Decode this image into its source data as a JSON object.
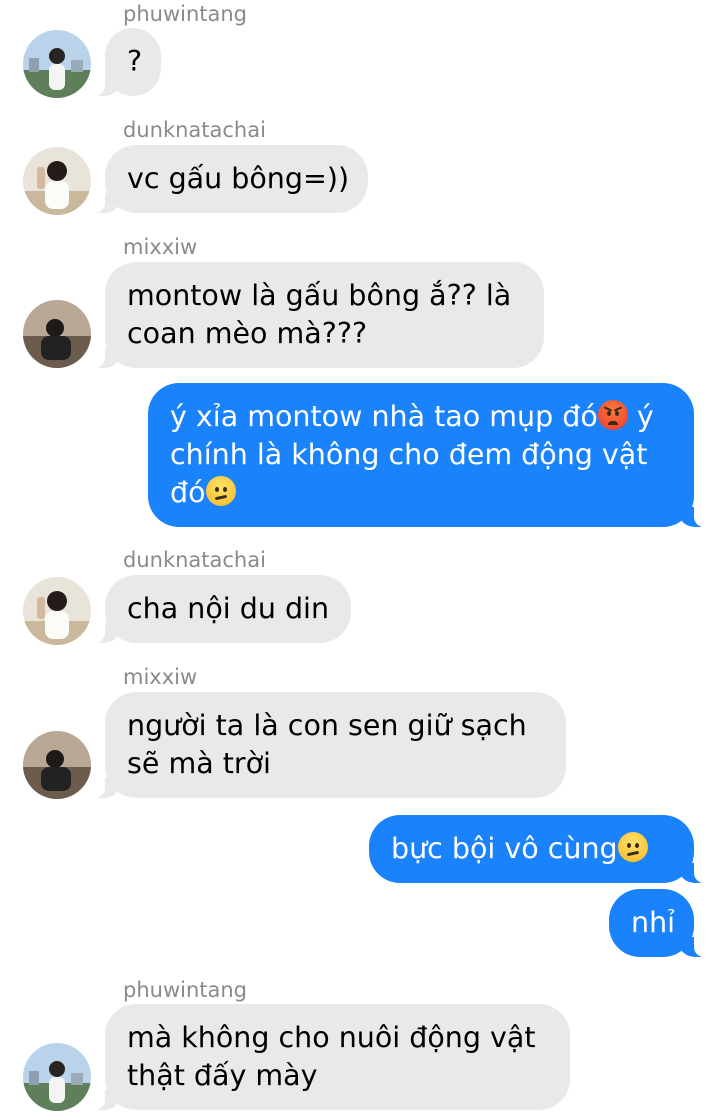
{
  "messages": [
    {
      "sender": "phuwintang",
      "lines": [
        "?"
      ],
      "avatar": "phuwintang-avatar"
    },
    {
      "sender": "dunknatachai",
      "lines": [
        "vc gấu bông=))"
      ],
      "avatar": "dunknatachai-avatar"
    },
    {
      "sender": "mixxiw",
      "lines": [
        "montow là gấu bông ắ?? là",
        "coan mèo mà???"
      ],
      "avatar": "mixxiw-avatar"
    },
    {
      "sender": "",
      "outgoing": true,
      "lines": [
        "ý xỉa montow nhà tao mụp đó",
        "ý",
        "chính là không cho đem động vật",
        "đó"
      ],
      "emoji": [
        "angry-face-icon",
        "confused-face-icon"
      ]
    },
    {
      "sender": "dunknatachai",
      "lines": [
        "cha nội du din"
      ],
      "avatar": "dunknatachai-avatar"
    },
    {
      "sender": "mixxiw",
      "lines": [
        "người ta là con sen giữ sạch",
        "sẽ mà trời"
      ],
      "avatar": "mixxiw-avatar"
    },
    {
      "sender": "",
      "outgoing": true,
      "lines": [
        "bực bội vô cùng"
      ],
      "emoji": [
        "confused-face-icon"
      ]
    },
    {
      "sender": "",
      "outgoing": true,
      "lines": [
        "nhỉ"
      ]
    },
    {
      "sender": "phuwintang",
      "lines": [
        "mà không cho nuôi động vật",
        "thật đấy mày"
      ],
      "avatar": "phuwintang-avatar"
    }
  ],
  "colors": {
    "incoming_bubble": "#e9e9eb",
    "outgoing_bubble": "#1a82fb",
    "sender_name": "#8a8a8e"
  }
}
